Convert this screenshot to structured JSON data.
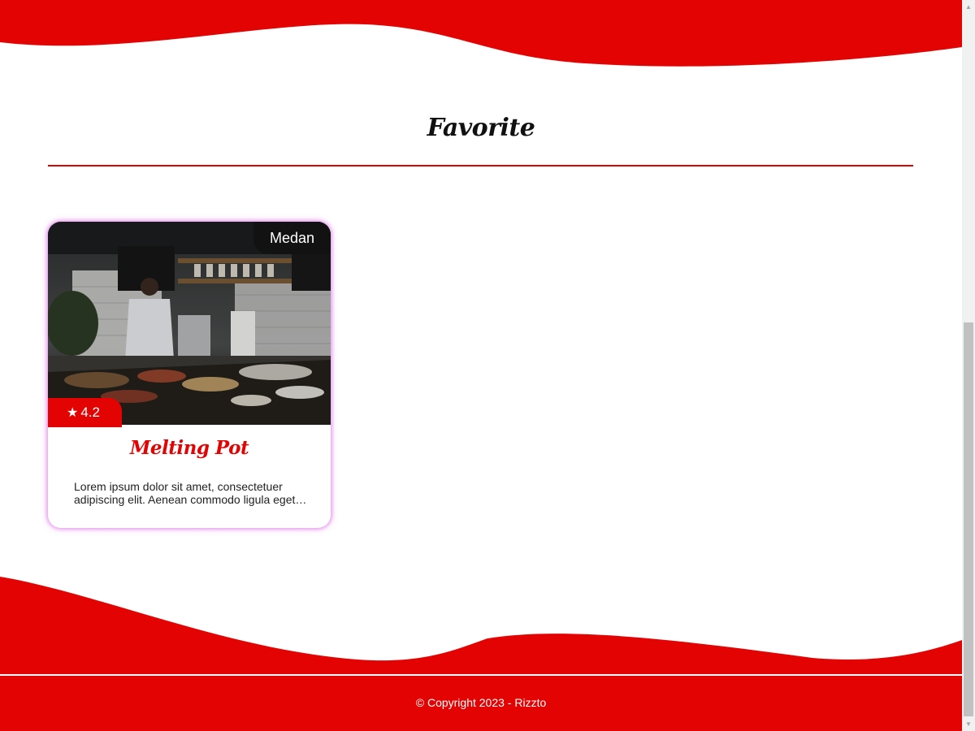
{
  "section": {
    "title": "Favorite"
  },
  "card": {
    "city": "Medan",
    "rating": "4.2",
    "rating_icon": "star-icon",
    "name": "Melting Pot",
    "description": "Lorem ipsum dolor sit amet, consectetuer adipiscing elit. Aenean commodo ligula eget dolor. Aenean massa."
  },
  "footer": {
    "copyright": "© Copyright 2023 - Rizzto"
  },
  "colors": {
    "accent": "#e40303",
    "tag_bg": "#121212",
    "card_glow": "#dc6ee6"
  }
}
